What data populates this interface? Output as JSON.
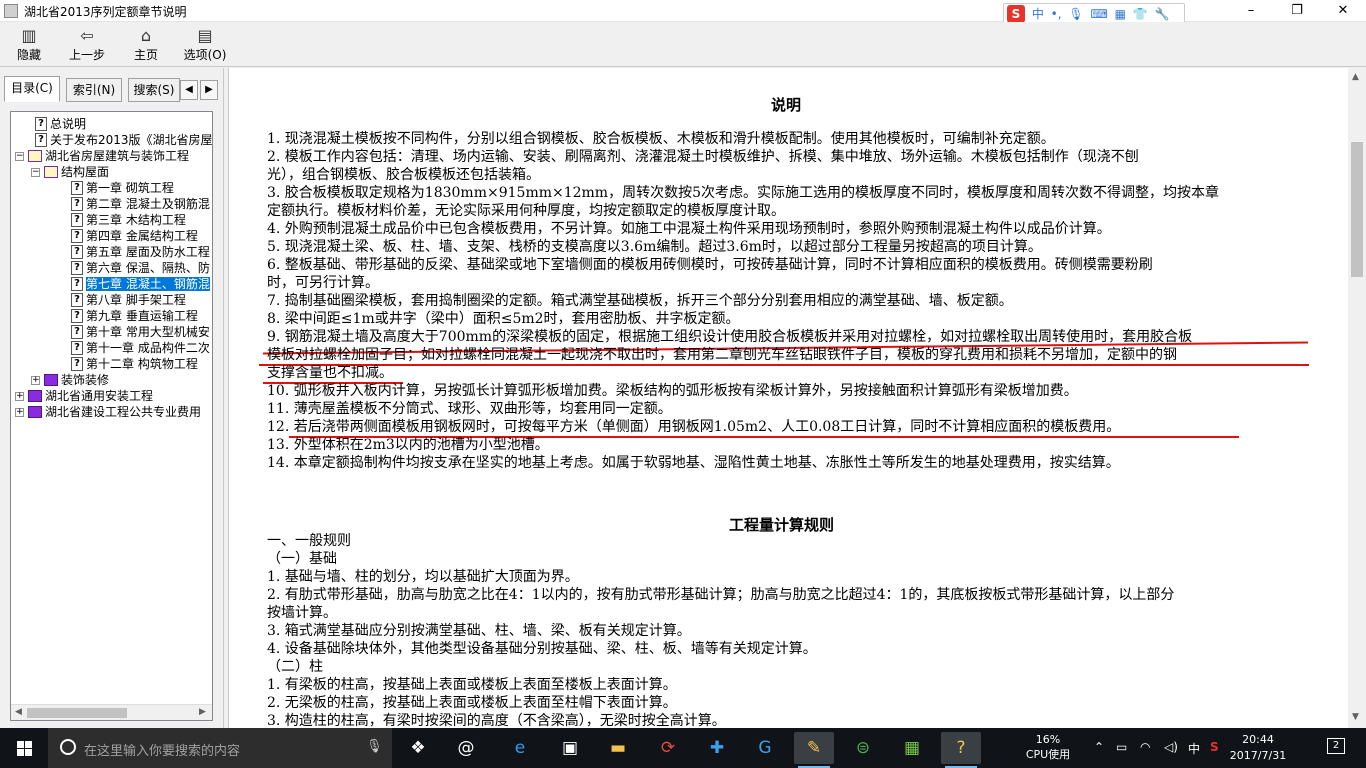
{
  "window": {
    "title": "湖北省2013序列定额章节说明",
    "minimize": "–",
    "restore": "❐",
    "close": "✕"
  },
  "ime": {
    "logo": "S",
    "lang": "中",
    "icons": [
      "dot-icon",
      "mic-icon",
      "keyboard-icon",
      "tools-icon",
      "shirt-icon",
      "wrench-icon"
    ]
  },
  "toolbar": {
    "hide": "隐藏",
    "back": "上一步",
    "home": "主页",
    "options": "选项(O)"
  },
  "tabs": {
    "contents": "目录(C)",
    "index": "索引(N)",
    "search": "搜索(S)"
  },
  "tree": [
    {
      "label": "总说明",
      "icon": "q",
      "level": 2
    },
    {
      "label": "关于发布2013版《湖北省房屋",
      "icon": "q",
      "level": 2
    },
    {
      "label": "湖北省房屋建筑与装饰工程",
      "icon": "book-open",
      "level": 1,
      "expander": "−"
    },
    {
      "label": "结构屋面",
      "icon": "book-open",
      "level": 2,
      "expander": "−"
    },
    {
      "label": "第一章 砌筑工程",
      "icon": "q",
      "level": 3
    },
    {
      "label": "第二章 混凝土及钢筋混",
      "icon": "q",
      "level": 3
    },
    {
      "label": "第三章 木结构工程",
      "icon": "q",
      "level": 3
    },
    {
      "label": "第四章 金属结构工程",
      "icon": "q",
      "level": 3
    },
    {
      "label": "第五章 屋面及防水工程",
      "icon": "q",
      "level": 3
    },
    {
      "label": "第六章 保温、隔热、防",
      "icon": "q",
      "level": 3
    },
    {
      "label": "第七章 混凝土、钢筋混",
      "icon": "q",
      "level": 3,
      "selected": true
    },
    {
      "label": "第八章 脚手架工程",
      "icon": "q",
      "level": 3
    },
    {
      "label": "第九章 垂直运输工程",
      "icon": "q",
      "level": 3
    },
    {
      "label": "第十章 常用大型机械安",
      "icon": "q",
      "level": 3
    },
    {
      "label": "第十一章 成品构件二次",
      "icon": "q",
      "level": 3
    },
    {
      "label": "第十二章 构筑物工程",
      "icon": "q",
      "level": 3
    },
    {
      "label": "装饰装修",
      "icon": "book",
      "level": 2,
      "expander": "+"
    },
    {
      "label": "湖北省通用安装工程",
      "icon": "book",
      "level": 1,
      "expander": "+"
    },
    {
      "label": "湖北省建设工程公共专业费用",
      "icon": "book",
      "level": 1,
      "expander": "+"
    }
  ],
  "doc": {
    "heading1": "说明",
    "lines1": [
      "1. 现浇混凝土模板按不同构件，分别以组合钢模板、胶合板模板、木模板和滑升模板配制。使用其他模板时，可编制补充定额。",
      "2. 模板工作内容包括：清理、场内运输、安装、刷隔离剂、浇灌混凝土时模板维护、拆模、集中堆放、场外运输。木模板包括制作（现浇不刨",
      "光），组合钢模板、胶合板模板还包括装箱。",
      "3. 胶合板模板取定规格为1830mm×915mm×12mm，周转次数按5次考虑。实际施工选用的模板厚度不同时，模板厚度和周转次数不得调整，均按本章",
      "定额执行。模板材料价差，无论实际采用何种厚度，均按定额取定的模板厚度计取。",
      "4. 外购预制混凝土成品价中已包含模板费用，不另计算。如施工中混凝土构件采用现场预制时，参照外购预制混凝土构件以成品价计算。",
      "5. 现浇混凝土梁、板、柱、墙、支架、栈桥的支模高度以3.6m编制。超过3.6m时，以超过部分工程量另按超高的项目计算。",
      "6. 整板基础、带形基础的反梁、基础梁或地下室墙侧面的模板用砖侧模时，可按砖基础计算，同时不计算相应面积的模板费用。砖侧模需要粉刷",
      "时，可另行计算。",
      "7. 捣制基础圈梁模板，套用捣制圈梁的定额。箱式满堂基础模板，拆开三个部分分别套用相应的满堂基础、墙、板定额。",
      "8. 梁中间距≤1m或井字（梁中）面积≤5m2时，套用密肋板、井字板定额。",
      "9. 钢筋混凝土墙及高度大于700mm的深梁模板的固定，根据施工组织设计使用胶合板模板并采用对拉螺栓，如对拉螺栓取出周转使用时，套用胶合板",
      "模板对拉螺栓加固子目；如对拉螺栓同混凝土一起现浇不取出时，套用第二章刨光车丝钻眼铁件子目，模板的穿孔费用和损耗不另增加，定额中的钢",
      "支撑含量也不扣减。",
      "10. 弧形板并入板内计算，另按弧长计算弧形板增加费。梁板结构的弧形板按有梁板计算外，另按接触面积计算弧形有梁板增加费。",
      "11. 薄壳屋盖模板不分筒式、球形、双曲形等，均套用同一定额。",
      "12. 若后浇带两侧面模板用钢板网时，可按每平方米（单侧面）用钢板网1.05m2、人工0.08工日计算，同时不计算相应面积的模板费用。",
      "13. 外型体积在2m3以内的池槽为小型池槽。",
      "14. 本章定额捣制构件均按支承在坚实的地基上考虑。如属于软弱地基、湿陷性黄土地基、冻胀性土等所发生的地基处理费用，按实结算。"
    ],
    "heading2": "工程量计算规则",
    "lines2": [
      "一、一般规则",
      "（一）基础",
      "1. 基础与墙、柱的划分，均以基础扩大顶面为界。",
      "2. 有肋式带形基础，肋高与肋宽之比在4：1以内的，按有肋式带形基础计算；肋高与肋宽之比超过4：1的，其底板按板式带形基础计算，以上部分",
      "按墙计算。",
      "3. 箱式满堂基础应分别按满堂基础、柱、墙、梁、板有关规定计算。",
      "4. 设备基础除块体外，其他类型设备基础分别按基础、梁、柱、板、墙等有关规定计算。",
      "（二）柱",
      "1. 有梁板的柱高，按基础上表面或楼板上表面至楼板上表面计算。",
      "2. 无梁板的柱高，按基础上表面或楼板上表面至柱帽下表面计算。",
      "3. 构造柱的柱高，有梁时按梁间的高度（不含梁高），无梁时按全高计算。"
    ]
  },
  "taskbar": {
    "search_placeholder": "在这里输入你要搜索的内容",
    "cpu_percent": "16%",
    "cpu_label": "CPU使用",
    "ime_lang": "中",
    "time": "20:44",
    "date": "2017/7/31",
    "notifications": "2",
    "colors": {
      "accent": "#0078d7",
      "annotation": "#e01010"
    }
  }
}
